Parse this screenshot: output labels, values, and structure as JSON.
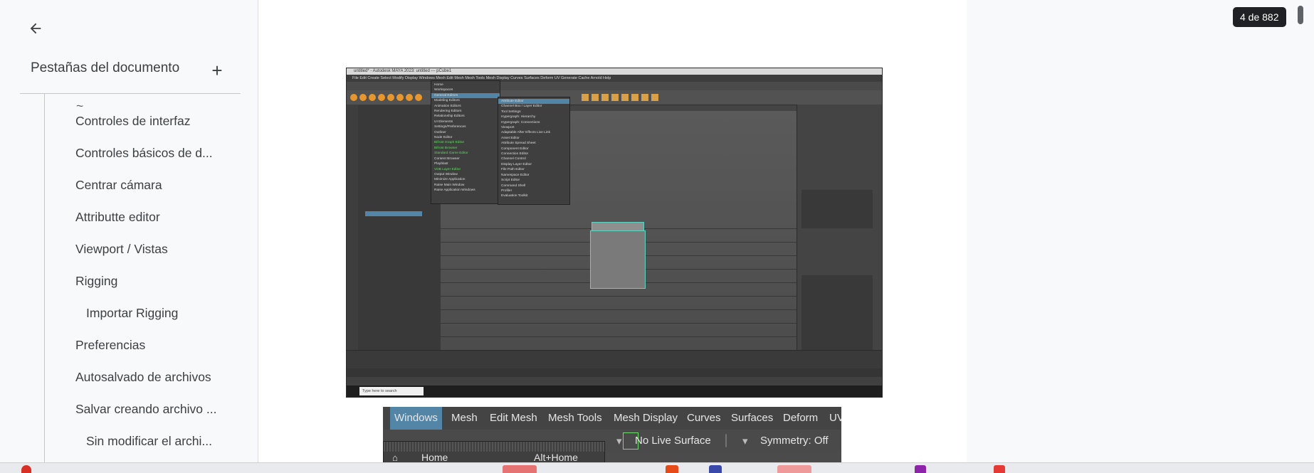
{
  "sidebar": {
    "back_label": "",
    "tabs_header": "Pestañas del documento",
    "add_symbol": "+",
    "outline_items": [
      {
        "label": "Controles de interfaz",
        "level": 1
      },
      {
        "label": "Controles básicos de d...",
        "level": 1
      },
      {
        "label": "Centrar cámara",
        "level": 1
      },
      {
        "label": "Attributte editor",
        "level": 1
      },
      {
        "label": "Viewport / Vistas",
        "level": 1
      },
      {
        "label": "Rigging",
        "level": 1
      },
      {
        "label": "Importar Rigging",
        "level": 2
      },
      {
        "label": "Preferencias",
        "level": 1
      },
      {
        "label": "Autosalvado de archivos",
        "level": 1
      },
      {
        "label": "Salvar creando archivo ...",
        "level": 1
      },
      {
        "label": "Sin modificar el archi...",
        "level": 2
      }
    ]
  },
  "viewer": {
    "page_indicator": "4 de 882"
  },
  "maya_screenshot": {
    "title": "untitled* - Autodesk MAYA 2023: untitled --- pCube1",
    "menu": "File  Edit  Create  Select  Modify  Display  Windows  Mesh  Edit Mesh  Mesh Tools  Mesh Display  Curves  Surfaces  Deform  UV  Generate  Cache  Arnold  Help",
    "taskbar_search": "Type here to search",
    "windows_menu_items": [
      "Home",
      "Workspaces",
      "General Editors",
      "Modeling Editors",
      "Animation Editors",
      "Rendering Editors",
      "Relationship Editors",
      "UI Elements",
      "Settings/Preferences",
      "Outliner",
      "Node Editor",
      "Bifrost Graph Editor",
      "Bifrost Browser",
      "Standard Game Editor",
      "Content Browser",
      "Playblast",
      "VDB Layer Editor",
      "Output Window",
      "Minimize Application",
      "Raise Main Window",
      "Raise Application Windows"
    ],
    "submenu_items": [
      "Attribute Editor",
      "Channel Box / Layer Editor",
      "Tool Settings",
      "Hypergraph: Hierarchy",
      "Hypergraph: Connections",
      "Viewport",
      "Adaptable After Effects Live Link",
      "Asset Editor",
      "Attribute Spread Sheet",
      "Component Editor",
      "Connection Editor",
      "Channel Control",
      "Display Layer Editor",
      "File Path Editor",
      "Namespace Editor",
      "Script Editor",
      "Command Shell",
      "Profiler",
      "Evaluation Toolkit"
    ]
  },
  "menu_crop": {
    "menu_items": [
      "Windows",
      "Mesh",
      "Edit Mesh",
      "Mesh Tools",
      "Mesh Display",
      "Curves",
      "Surfaces",
      "Deform",
      "UV"
    ],
    "live_surface": "No Live Surface",
    "symmetry": "Symmetry: Off",
    "home_label": "Home",
    "home_shortcut": "Alt+Home"
  },
  "colors": {
    "maya_highlight": "#5285a6",
    "badge_bg": "#202124",
    "cube_edge": "#5fd3c0"
  }
}
